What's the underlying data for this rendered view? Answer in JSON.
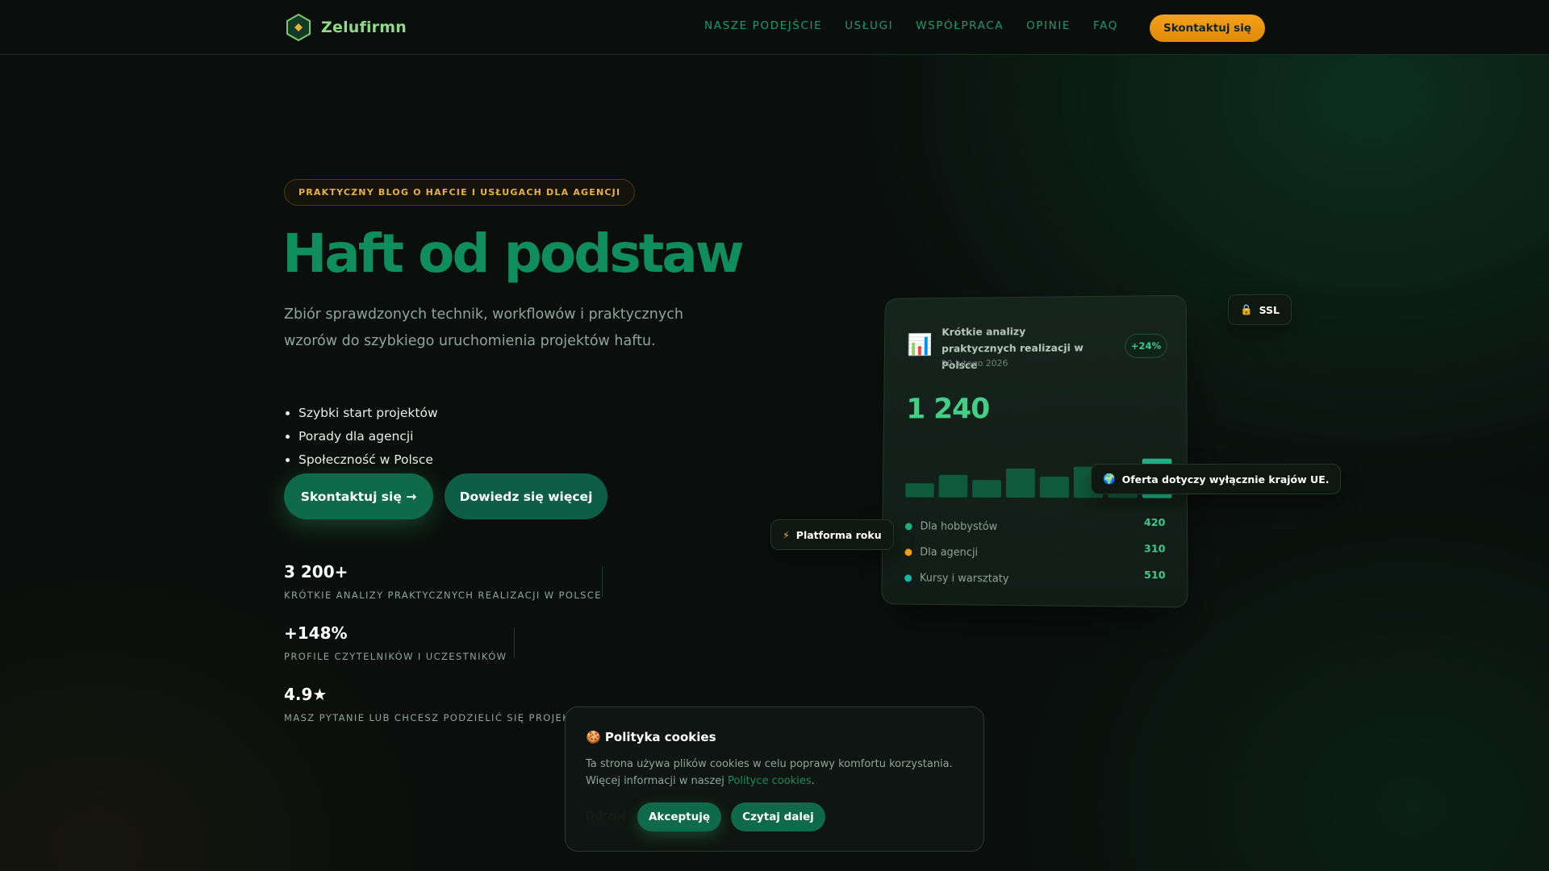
{
  "header": {
    "brand_name": "Zelufirmn",
    "logo_icon": "hexagon-diamond-icon",
    "nav": [
      {
        "label": "NASZE PODEJŚCIE"
      },
      {
        "label": "USŁUGI"
      },
      {
        "label": "WSPÓŁPRACA"
      },
      {
        "label": "OPINIE"
      },
      {
        "label": "FAQ"
      }
    ],
    "cta_label": "Skontaktuj się"
  },
  "hero": {
    "badge": "PRAKTYCZNY BLOG O HAFCIE I USŁUGACH DLA AGENCJI",
    "title": "Haft od podstaw",
    "subtitle": "Zbiór sprawdzonych technik, workflowów i praktycznych wzorów do szybkiego uruchomienia projektów haftu.",
    "features": [
      "Szybki start projektów",
      "Porady dla agencji",
      "Społeczność w Polsce"
    ],
    "primary_button": "Skontaktuj się →",
    "secondary_button": "Dowiedz się więcej"
  },
  "stats": [
    {
      "value": "3 200+",
      "label": "KRÓTKIE ANALIZY PRAKTYCZNYCH REALIZACJI W POLSCE"
    },
    {
      "value": "+148%",
      "label": "PROFILE CZYTELNIKÓW I UCZESTNIKÓW"
    },
    {
      "value": "4.9★",
      "label": "MASZ PYTANIE LUB CHCESZ PODZIELIĆ SIĘ PROJEKTEM"
    }
  ],
  "card": {
    "icon": "bar-chart-icon",
    "title": "Krótkie analizy praktycznych realizacji w Polsce",
    "date": "20 lutego 2026",
    "change": "+24%",
    "big_number": "1 240",
    "bars": [
      0.28,
      0.45,
      0.35,
      0.58,
      0.42,
      0.62,
      0.55,
      0.78
    ],
    "legend": [
      {
        "name": "Dla hobbystów",
        "value": "420",
        "color": "#1fb27a"
      },
      {
        "name": "Dla agencji",
        "value": "310",
        "color": "#f0a019"
      },
      {
        "name": "Kursy i warsztaty",
        "value": "510",
        "color": "#17b9a6"
      }
    ]
  },
  "floats": {
    "ssl_label": "SSL",
    "ssl_icon": "lock-icon",
    "eu_label": "Oferta dotyczy wyłącznie krajów UE.",
    "eu_icon": "globe-icon",
    "platform_label": "Platforma roku",
    "platform_icon": "lightning-icon"
  },
  "cookie": {
    "icon": "cookie-icon",
    "title": "Polityka cookies",
    "text": "Ta strona używa plików cookies w celu poprawy komfortu korzystania. Więcej informacji w naszej",
    "link": "Polityce cookies",
    "reject": "Odrzuć",
    "accept": "Akceptuję",
    "more": "Czytaj dalej"
  },
  "colors": {
    "accent": "#0e6a4a",
    "title_green": "#0f8d5c",
    "cta_orange": "#f4a11a",
    "badge_gold": "#e9b23a"
  }
}
